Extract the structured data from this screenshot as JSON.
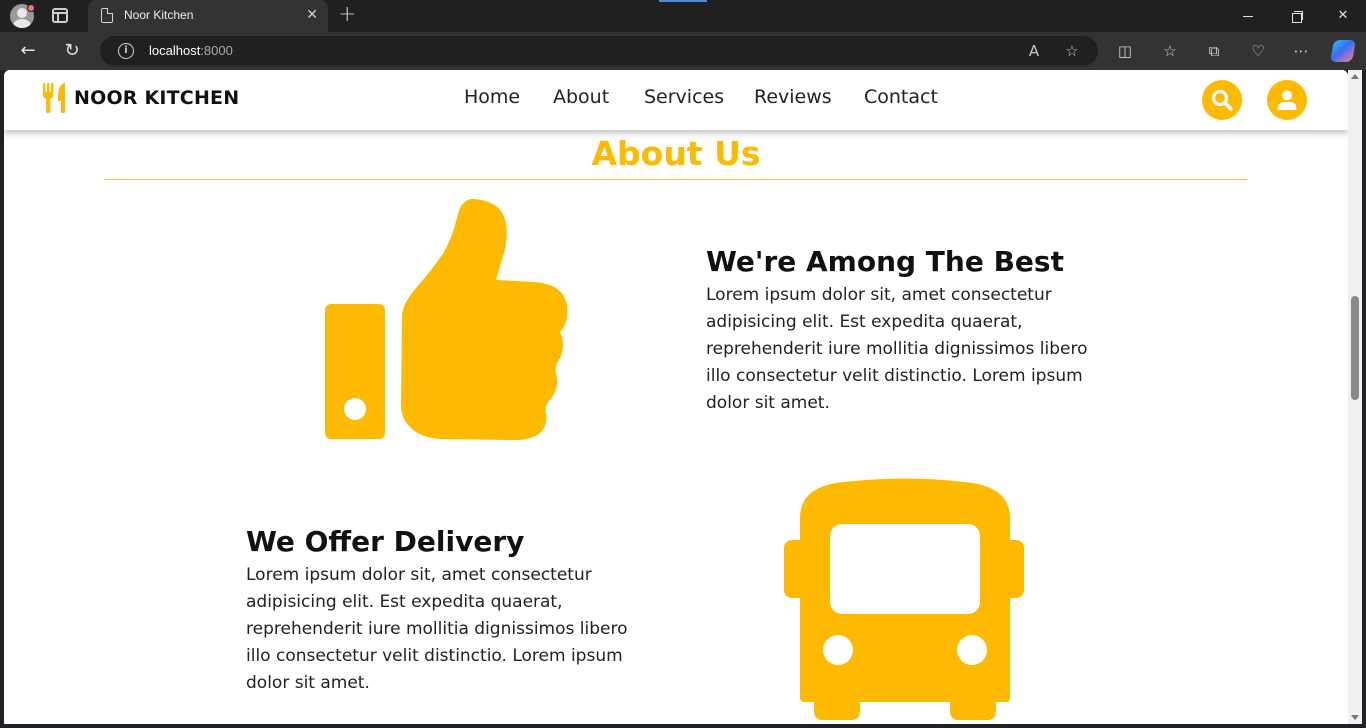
{
  "browser": {
    "tab_title": "Noor Kitchen",
    "url_host": "localhost",
    "url_port": ":8000"
  },
  "site": {
    "logo_text": "NOOR KITCHEN",
    "nav": [
      "Home",
      "About",
      "Services",
      "Reviews",
      "Contact"
    ],
    "accent_color": "#fdba00"
  },
  "about": {
    "title": "About Us",
    "items": [
      {
        "heading": "We're Among The Best",
        "text": "Lorem ipsum dolor sit, amet consectetur adipisicing elit. Est expedita quaerat, reprehenderit iure mollitia dignissimos libero illo consectetur velit distinctio. Lorem ipsum dolor sit amet.",
        "icon": "thumbs-up-icon"
      },
      {
        "heading": "We Offer Delivery",
        "text": "Lorem ipsum dolor sit, amet consectetur adipisicing elit. Est expedita quaerat, reprehenderit iure mollitia dignissimos libero illo consectetur velit distinctio. Lorem ipsum dolor sit amet.",
        "icon": "bus-icon"
      }
    ]
  }
}
